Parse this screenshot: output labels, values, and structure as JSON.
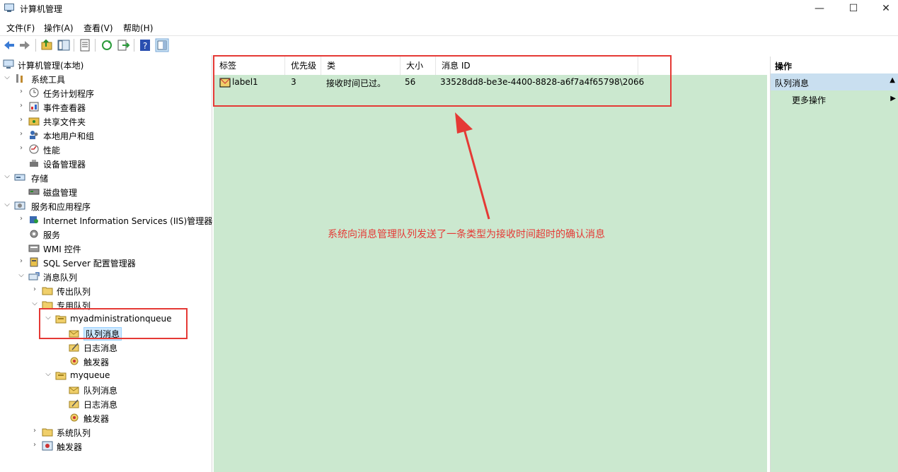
{
  "window": {
    "title": "计算机管理",
    "minimize": "—",
    "maximize": "☐",
    "close": "✕"
  },
  "menu": [
    "文件(F)",
    "操作(A)",
    "查看(V)",
    "帮助(H)"
  ],
  "tree": [
    {
      "label": "计算机管理(本地)",
      "icon": "computer-icon"
    },
    {
      "label": "系统工具",
      "icon": "tools-icon"
    },
    {
      "label": "任务计划程序",
      "icon": "clock-icon"
    },
    {
      "label": "事件查看器",
      "icon": "event-viewer-icon"
    },
    {
      "label": "共享文件夹",
      "icon": "shared-folder-icon"
    },
    {
      "label": "本地用户和组",
      "icon": "users-icon"
    },
    {
      "label": "性能",
      "icon": "performance-icon"
    },
    {
      "label": "设备管理器",
      "icon": "device-manager-icon"
    },
    {
      "label": "存储",
      "icon": "storage-icon"
    },
    {
      "label": "磁盘管理",
      "icon": "disk-icon"
    },
    {
      "label": "服务和应用程序",
      "icon": "services-apps-icon"
    },
    {
      "label": "Internet Information Services (IIS)管理器",
      "icon": "iis-icon"
    },
    {
      "label": "服务",
      "icon": "gear-icon"
    },
    {
      "label": "WMI 控件",
      "icon": "wmi-icon"
    },
    {
      "label": "SQL Server 配置管理器",
      "icon": "sql-server-icon"
    },
    {
      "label": "消息队列",
      "icon": "message-queue-icon"
    },
    {
      "label": "传出队列",
      "icon": "folder-icon"
    },
    {
      "label": "专用队列",
      "icon": "folder-icon"
    },
    {
      "label": "myadministrationqueue",
      "icon": "queue-icon"
    },
    {
      "label": "队列消息",
      "icon": "queue-messages-icon"
    },
    {
      "label": "日志消息",
      "icon": "journal-icon"
    },
    {
      "label": "触发器",
      "icon": "trigger-icon"
    },
    {
      "label": "myqueue",
      "icon": "queue-icon"
    },
    {
      "label": "队列消息",
      "icon": "queue-messages-icon"
    },
    {
      "label": "日志消息",
      "icon": "journal-icon"
    },
    {
      "label": "触发器",
      "icon": "trigger-icon"
    },
    {
      "label": "系统队列",
      "icon": "folder-icon"
    },
    {
      "label": "触发器",
      "icon": "trigger-icon"
    }
  ],
  "list": {
    "columns": [
      "标签",
      "优先级",
      "类",
      "大小",
      "消息 ID"
    ],
    "rows": [
      {
        "label": "label1",
        "priority": "3",
        "class": "接收时间已过。",
        "size": "56",
        "id": "33528dd8-be3e-4400-8828-a6f7a4f65798\\2066"
      }
    ]
  },
  "actions": {
    "header": "操作",
    "section": "队列消息",
    "more": "更多操作"
  },
  "annotation": "系统向消息管理队列发送了一条类型为接收时间超时的确认消息",
  "colors": {
    "list_bg": "#cbe8cf",
    "callout": "#e53935",
    "selection": "#cce8ff"
  }
}
